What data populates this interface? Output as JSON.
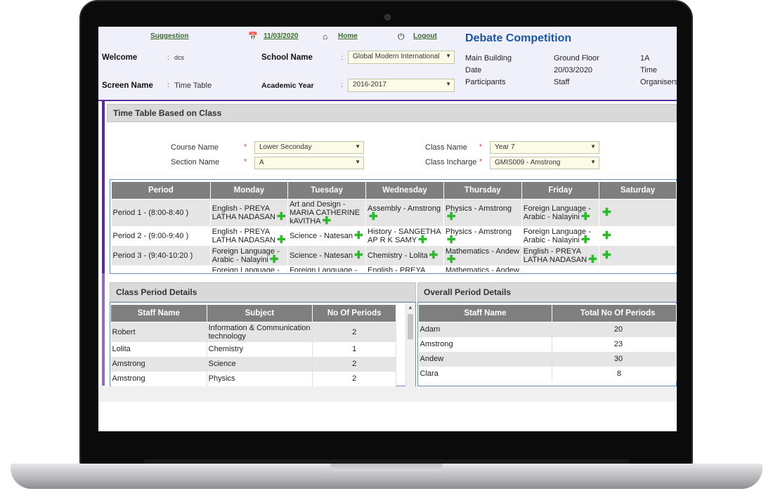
{
  "header": {
    "suggestion": "Suggestion",
    "date": "11/03/2020",
    "home": "Home",
    "logout": "Logout",
    "welcome_label": "Welcome",
    "welcome_value": "dcs",
    "screen_name_label": "Screen Name",
    "screen_name_value": "Time Table",
    "school_name_label": "School Name",
    "school_name_value": "Global Modern International",
    "academic_year_label": "Academic Year",
    "academic_year_value": "2016-2017",
    "colon": ":"
  },
  "event": {
    "title": "Debate Competition",
    "main_building": "Main Building",
    "ground_floor": "Ground Floor",
    "room": "1A",
    "date_label": "Date",
    "date_value": "20/03/2020",
    "time_label": "Time",
    "participants_label": "Participants",
    "participants_value": "Staff",
    "organisers_label": "Organisers"
  },
  "timetable_panel": {
    "title": "Time Table Based on Class",
    "course_name_label": "Course Name",
    "course_name_value": "Lower Seconday",
    "section_name_label": "Section Name",
    "section_name_value": "A",
    "class_name_label": "Class Name",
    "class_name_value": "Year 7",
    "class_incharge_label": "Class Incharge",
    "class_incharge_value": "GMIS009 - Amstrong",
    "required": "*"
  },
  "timetable": {
    "headers": [
      "Period",
      "Monday",
      "Tuesday",
      "Wednesday",
      "Thursday",
      "Friday",
      "Saturday"
    ],
    "rows": [
      {
        "period": "Period 1 - (8:00-8:40 )",
        "cells": [
          "English - PREYA LATHA NADASAN",
          "Art and Design - MARIA CATHERINE kAVITHA",
          "Assembly - Amstrong",
          "Physics - Amstrong",
          "Foreign Language - Arabic - Nalayini",
          ""
        ]
      },
      {
        "period": "Period 2 - (9:00-9:40 )",
        "cells": [
          "English - PREYA LATHA NADASAN",
          "Science - Natesan",
          "History - SANGETHA AP R K SAMY",
          "Physics - Amstrong",
          "Foreign Language - Arabic - Nalayini",
          ""
        ]
      },
      {
        "period": "Period 3 - (9:40-10:20 )",
        "cells": [
          "Foreign Language - Arabic - Nalayini",
          "Science - Natesan",
          "Chemistry - Lolita",
          "Mathematics - Andew",
          "English - PREYA LATHA NADASAN",
          ""
        ]
      },
      {
        "period": "",
        "cells": [
          "Foreign Language -",
          "Foreign Language -",
          "English - PREYA",
          "Mathematics - Andew",
          "",
          ""
        ]
      }
    ]
  },
  "class_period": {
    "title": "Class Period Details",
    "headers": [
      "Staff Name",
      "Subject",
      "No Of Periods"
    ],
    "rows": [
      [
        "Robert",
        "Information & Communication technology",
        "2"
      ],
      [
        "Lolita",
        "Chemistry",
        "1"
      ],
      [
        "Amstrong",
        "Science",
        "2"
      ],
      [
        "Amstrong",
        "Physics",
        "2"
      ]
    ]
  },
  "overall_period": {
    "title": "Overall Period Details",
    "headers": [
      "Staff Name",
      "Total No Of Periods"
    ],
    "rows": [
      [
        "Adam",
        "20"
      ],
      [
        "Amstrong",
        "23"
      ],
      [
        "Andew",
        "30"
      ],
      [
        "Clara",
        "8"
      ]
    ]
  },
  "icons": {
    "calendar": "calendar-icon",
    "home": "home-icon",
    "power": "power-icon",
    "plus": "add-icon",
    "dropdown": "chevron-down-icon"
  },
  "colors": {
    "accent": "#5b2d9c",
    "title_blue": "#1a56a0",
    "link_green": "#3a6b2a",
    "add_green": "#2db82d",
    "table_header": "#7f7f7f"
  }
}
